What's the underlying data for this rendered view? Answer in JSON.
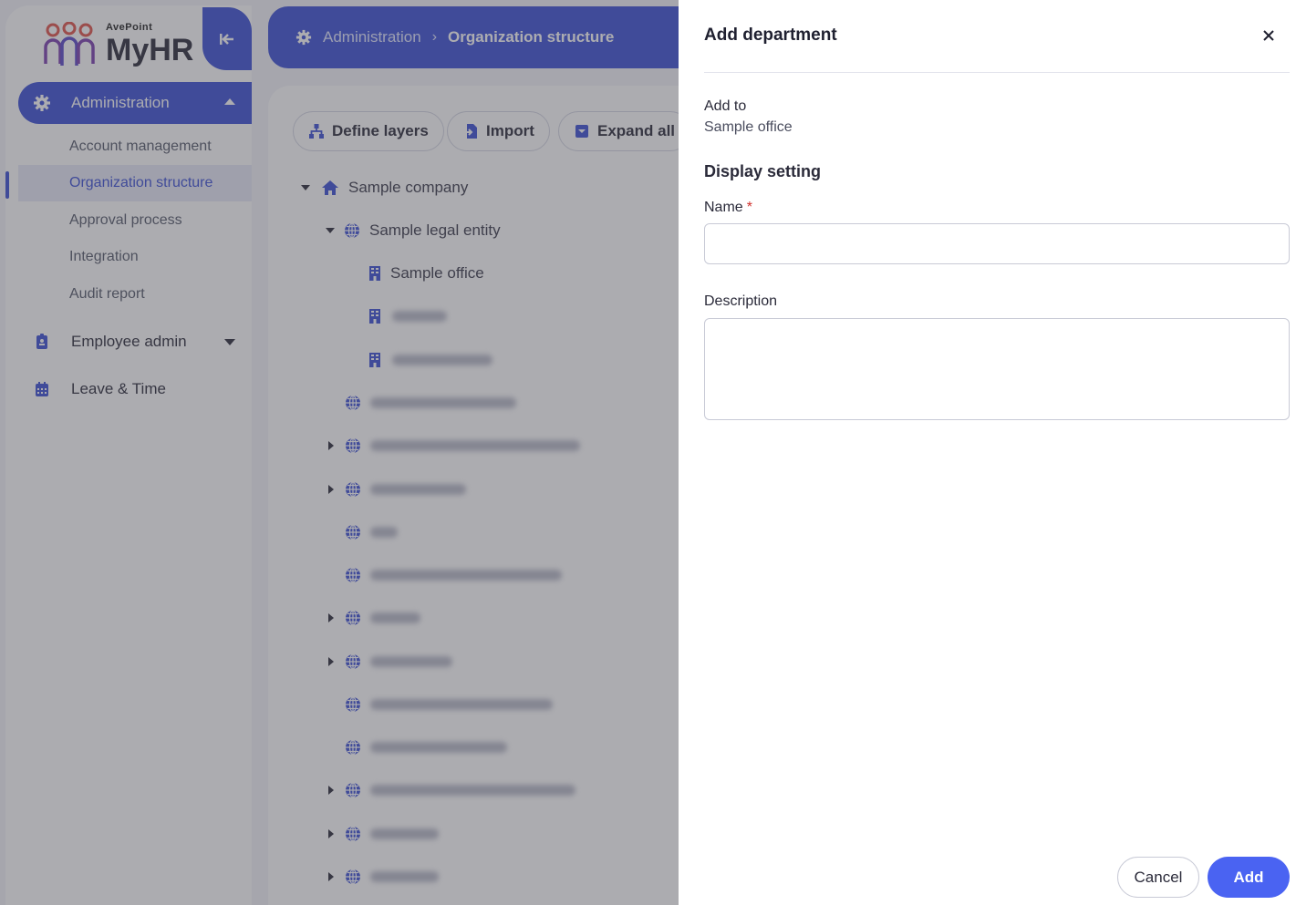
{
  "brand": {
    "company": "AvePoint",
    "product": "MyHR"
  },
  "colors": {
    "primary": "#3b4fd6",
    "button_primary": "#4a63f2",
    "required": "#d0312d"
  },
  "sidebar": {
    "sections": [
      {
        "label": "Administration",
        "icon": "gear-icon",
        "expanded": true,
        "items": [
          {
            "label": "Account management"
          },
          {
            "label": "Organization structure",
            "active": true
          },
          {
            "label": "Approval process"
          },
          {
            "label": "Integration"
          },
          {
            "label": "Audit report"
          }
        ]
      },
      {
        "label": "Employee admin",
        "icon": "id-badge-icon",
        "expanded": false
      },
      {
        "label": "Leave & Time",
        "icon": "calendar-icon"
      }
    ]
  },
  "header": {
    "breadcrumb": [
      "Administration",
      "Organization structure"
    ]
  },
  "toolbar": {
    "define_layers": "Define layers",
    "import": "Import",
    "expand_all": "Expand all"
  },
  "tree": {
    "root": "Sample company",
    "entity": "Sample legal entity",
    "office": "Sample office"
  },
  "drawer": {
    "title": "Add department",
    "add_to_label": "Add to",
    "add_to_value": "Sample office",
    "section_title": "Display setting",
    "name_label": "Name",
    "name_required_mark": "*",
    "name_value": "",
    "description_label": "Description",
    "description_value": "",
    "cancel_label": "Cancel",
    "add_label": "Add"
  }
}
